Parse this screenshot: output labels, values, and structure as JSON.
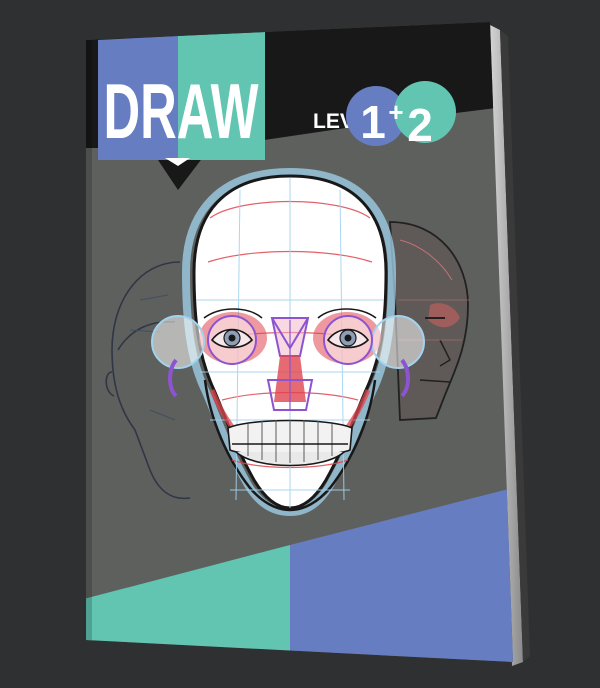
{
  "cover": {
    "title": "DRAW",
    "level_label": "LEVEL",
    "level_first": "1",
    "level_plus": "+",
    "level_second": "2"
  },
  "colors": {
    "background": "#2e3031",
    "cover_gray": "#595b58",
    "banner_black": "#111111",
    "accent_blue": "#6279c1",
    "accent_teal": "#5cc4af",
    "skull_white": "#ffffff",
    "guide_red": "#e0404a",
    "guide_purple": "#8a4fd0",
    "guide_blue": "#9fd2ee"
  }
}
